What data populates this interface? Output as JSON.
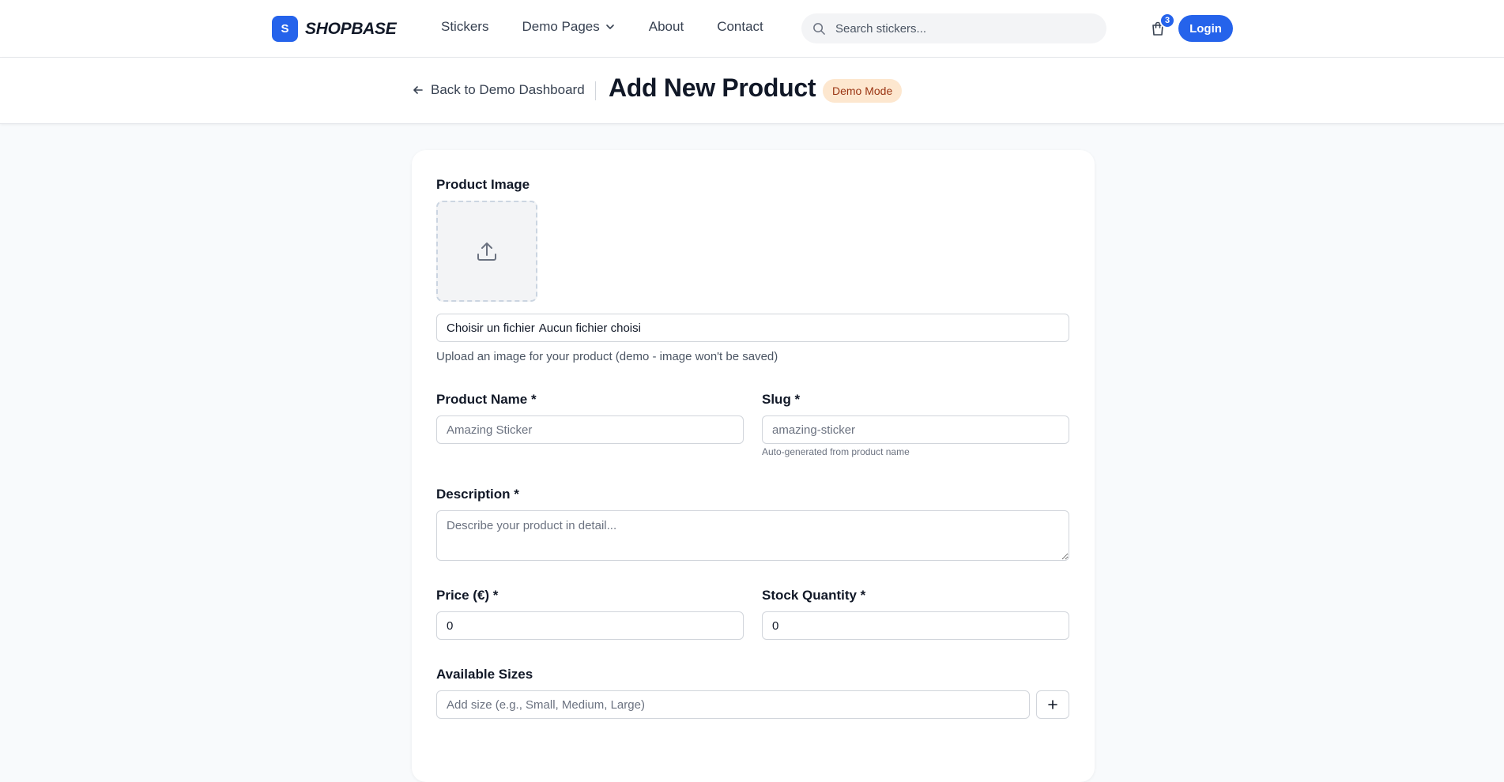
{
  "nav": {
    "brand_letter": "S",
    "brand_name": "SHOPBASE",
    "links": [
      "Stickers",
      "Demo Pages",
      "About",
      "Contact"
    ],
    "search_placeholder": "Search stickers...",
    "cart_count": "3",
    "login_label": "Login"
  },
  "subheader": {
    "back_label": "Back to Demo Dashboard",
    "title": "Add New Product",
    "badge": "Demo Mode"
  },
  "form": {
    "image_label": "Product Image",
    "file_button": "Choisir un fichier",
    "file_status": "Aucun fichier choisi",
    "image_hint": "Upload an image for your product (demo - image won't be saved)",
    "name_label": "Product Name *",
    "name_placeholder": "Amazing Sticker",
    "slug_label": "Slug *",
    "slug_placeholder": "amazing-sticker",
    "slug_hint": "Auto-generated from product name",
    "description_label": "Description *",
    "description_placeholder": "Describe your product in detail...",
    "price_label": "Price (€) *",
    "price_value": "0",
    "stock_label": "Stock Quantity *",
    "stock_value": "0",
    "sizes_label": "Available Sizes",
    "sizes_placeholder": "Add size (e.g., Small, Medium, Large)"
  },
  "colors": {
    "accent": "#2563eb",
    "badge_bg": "#fde7cf",
    "badge_text": "#9a3412"
  }
}
